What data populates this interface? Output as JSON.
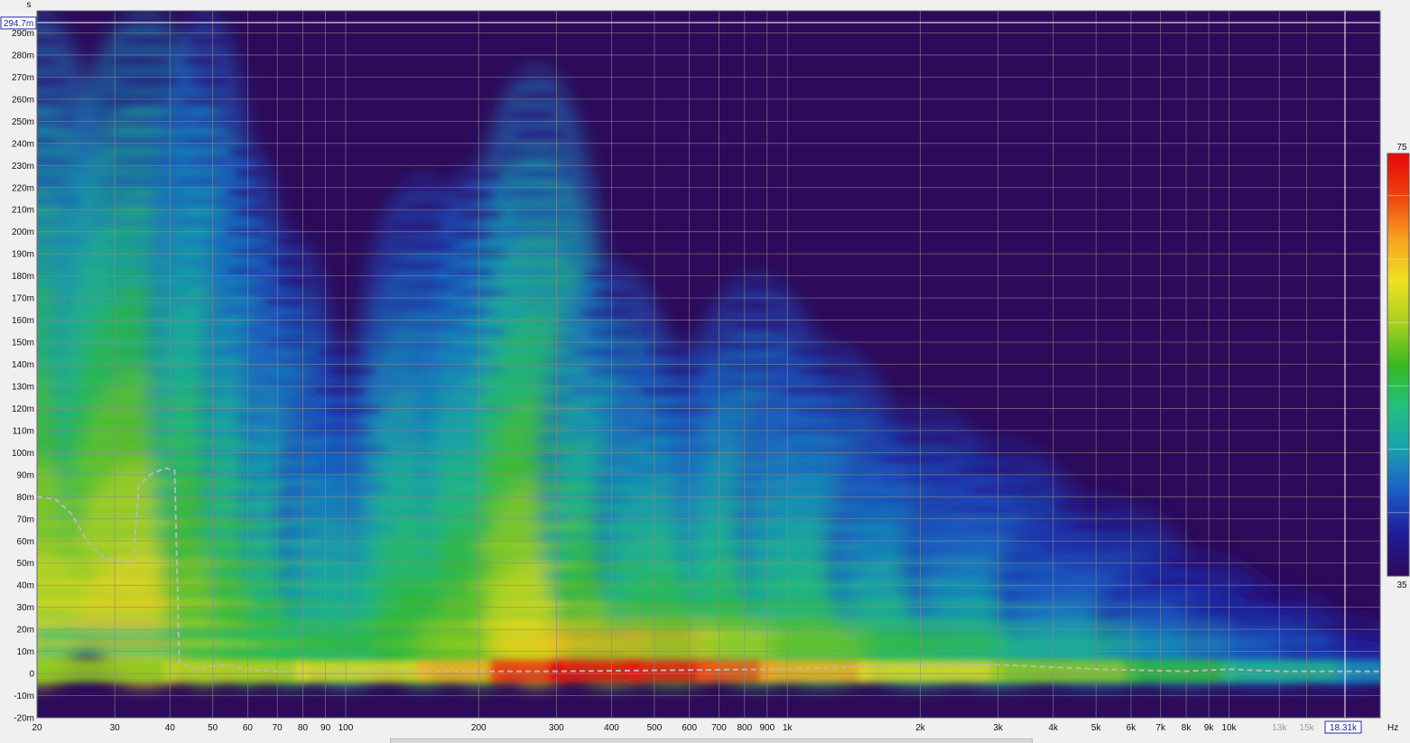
{
  "chart_data": {
    "type": "heatmap",
    "title": "",
    "x_axis": {
      "unit_label": "Hz",
      "scale": "log",
      "range_hz": [
        20,
        22000
      ],
      "ticks": [
        {
          "v": 20,
          "label": "20"
        },
        {
          "v": 30,
          "label": "30"
        },
        {
          "v": 40,
          "label": "40"
        },
        {
          "v": 50,
          "label": "50"
        },
        {
          "v": 60,
          "label": "60"
        },
        {
          "v": 70,
          "label": "70"
        },
        {
          "v": 80,
          "label": "80"
        },
        {
          "v": 90,
          "label": "90"
        },
        {
          "v": 100,
          "label": "100"
        },
        {
          "v": 200,
          "label": "200"
        },
        {
          "v": 300,
          "label": "300"
        },
        {
          "v": 400,
          "label": "400"
        },
        {
          "v": 500,
          "label": "500"
        },
        {
          "v": 600,
          "label": "600"
        },
        {
          "v": 700,
          "label": "700"
        },
        {
          "v": 800,
          "label": "800"
        },
        {
          "v": 900,
          "label": "900"
        },
        {
          "v": 1000,
          "label": "1k"
        },
        {
          "v": 2000,
          "label": "2k"
        },
        {
          "v": 3000,
          "label": "3k"
        },
        {
          "v": 4000,
          "label": "4k"
        },
        {
          "v": 5000,
          "label": "5k"
        },
        {
          "v": 6000,
          "label": "6k"
        },
        {
          "v": 7000,
          "label": "7k"
        },
        {
          "v": 8000,
          "label": "8k"
        },
        {
          "v": 9000,
          "label": "9k"
        },
        {
          "v": 10000,
          "label": "10k"
        },
        {
          "v": 13000,
          "label": "13k",
          "dim": true
        },
        {
          "v": 15000,
          "label": "15k",
          "dim": true
        }
      ]
    },
    "y_axis": {
      "unit_label": "s",
      "range_ms": [
        -20,
        300
      ],
      "ticks": [
        {
          "v": -20,
          "label": "-20m"
        },
        {
          "v": -10,
          "label": "-10m"
        },
        {
          "v": 0,
          "label": "0"
        },
        {
          "v": 10,
          "label": "10m"
        },
        {
          "v": 20,
          "label": "20m"
        },
        {
          "v": 30,
          "label": "30m"
        },
        {
          "v": 40,
          "label": "40m"
        },
        {
          "v": 50,
          "label": "50m"
        },
        {
          "v": 60,
          "label": "60m"
        },
        {
          "v": 70,
          "label": "70m"
        },
        {
          "v": 80,
          "label": "80m"
        },
        {
          "v": 90,
          "label": "90m"
        },
        {
          "v": 100,
          "label": "100m"
        },
        {
          "v": 110,
          "label": "110m"
        },
        {
          "v": 120,
          "label": "120m"
        },
        {
          "v": 130,
          "label": "130m"
        },
        {
          "v": 140,
          "label": "140m"
        },
        {
          "v": 150,
          "label": "150m"
        },
        {
          "v": 160,
          "label": "160m"
        },
        {
          "v": 170,
          "label": "170m"
        },
        {
          "v": 180,
          "label": "180m"
        },
        {
          "v": 190,
          "label": "190m"
        },
        {
          "v": 200,
          "label": "200m"
        },
        {
          "v": 210,
          "label": "210m"
        },
        {
          "v": 220,
          "label": "220m"
        },
        {
          "v": 230,
          "label": "230m"
        },
        {
          "v": 240,
          "label": "240m"
        },
        {
          "v": 250,
          "label": "250m"
        },
        {
          "v": 260,
          "label": "260m"
        },
        {
          "v": 270,
          "label": "270m"
        },
        {
          "v": 280,
          "label": "280m"
        },
        {
          "v": 290,
          "label": "290m"
        }
      ]
    },
    "cursor": {
      "time_ms": 294.7,
      "time_label": "294.7m",
      "freq_hz": 18310,
      "freq_label": "18.31k"
    },
    "color_scale": {
      "min": 35,
      "max": 75,
      "min_label": "35",
      "max_label": "75",
      "stops": [
        "#2e0a5c",
        "#1f1c9a",
        "#1c5cc8",
        "#18a0b0",
        "#22c080",
        "#3ab820",
        "#a8d020",
        "#f0e020",
        "#f8a020",
        "#f04010",
        "#e80808"
      ]
    },
    "background_color": "#2d0a5a",
    "features": {
      "decay_peaks": [
        {
          "freq_hz": 20,
          "decay_ms": 300,
          "level": 62
        },
        {
          "freq_hz": 35,
          "decay_ms": 300,
          "level": 64
        },
        {
          "freq_hz": 48,
          "decay_ms": 300,
          "level": 58
        },
        {
          "freq_hz": 60,
          "decay_ms": 240,
          "level": 56
        },
        {
          "freq_hz": 75,
          "decay_ms": 200,
          "level": 54
        },
        {
          "freq_hz": 100,
          "decay_ms": 150,
          "level": 52
        },
        {
          "freq_hz": 150,
          "decay_ms": 225,
          "level": 55
        },
        {
          "freq_hz": 200,
          "decay_ms": 230,
          "level": 57
        },
        {
          "freq_hz": 270,
          "decay_ms": 275,
          "level": 62
        },
        {
          "freq_hz": 400,
          "decay_ms": 185,
          "level": 58
        },
        {
          "freq_hz": 550,
          "decay_ms": 150,
          "level": 56
        },
        {
          "freq_hz": 850,
          "decay_ms": 180,
          "level": 55
        },
        {
          "freq_hz": 1200,
          "decay_ms": 150,
          "level": 54
        },
        {
          "freq_hz": 2000,
          "decay_ms": 120,
          "level": 52
        },
        {
          "freq_hz": 3000,
          "decay_ms": 105,
          "level": 50
        },
        {
          "freq_hz": 5000,
          "decay_ms": 80,
          "level": 48
        },
        {
          "freq_hz": 8000,
          "decay_ms": 55,
          "level": 46
        },
        {
          "freq_hz": 12000,
          "decay_ms": 40,
          "level": 44
        },
        {
          "freq_hz": 18000,
          "decay_ms": 25,
          "level": 42
        }
      ],
      "window_curve": [
        [
          20,
          80
        ],
        [
          22,
          79
        ],
        [
          24,
          72
        ],
        [
          26,
          60
        ],
        [
          28,
          53
        ],
        [
          30,
          51
        ],
        [
          33,
          50
        ],
        [
          34,
          85
        ],
        [
          36,
          90
        ],
        [
          39,
          93
        ],
        [
          41,
          92
        ],
        [
          42,
          5
        ],
        [
          45,
          2
        ],
        [
          52,
          4
        ],
        [
          60,
          2
        ],
        [
          70,
          1
        ],
        [
          100,
          1
        ],
        [
          300,
          1
        ],
        [
          1000,
          2
        ],
        [
          2000,
          4
        ],
        [
          3000,
          4
        ],
        [
          5000,
          2
        ],
        [
          8000,
          1
        ],
        [
          10000,
          2
        ],
        [
          13000,
          1
        ],
        [
          22000,
          1
        ]
      ]
    }
  }
}
